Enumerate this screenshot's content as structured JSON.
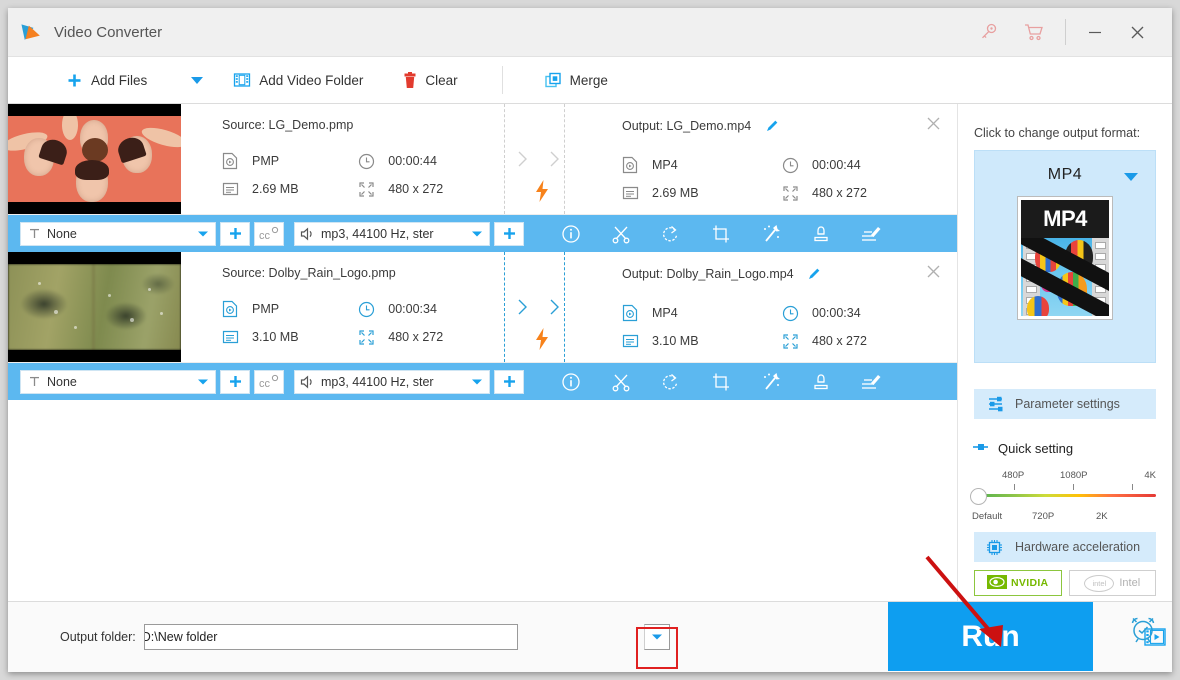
{
  "window": {
    "title": "Video Converter",
    "icons": {
      "key": "key-icon",
      "cart": "cart-icon",
      "minimize": "minimize-icon",
      "close": "close-icon"
    }
  },
  "toolbar": {
    "add_files": "Add Files",
    "add_files_dropdown": "chevron-down-icon",
    "add_video_folder": "Add Video Folder",
    "clear": "Clear",
    "merge": "Merge"
  },
  "files": [
    {
      "source_label": "Source: LG_Demo.pmp",
      "source_format": "PMP",
      "source_duration": "00:00:44",
      "source_size": "2.69 MB",
      "source_resolution": "480 x 272",
      "output_label": "Output: LG_Demo.mp4",
      "output_format": "MP4",
      "output_duration": "00:00:44",
      "output_size": "2.69 MB",
      "output_resolution": "480 x 272",
      "subtitle_track": "None",
      "audio_track": "mp3, 44100 Hz, ster",
      "active": false
    },
    {
      "source_label": "Source: Dolby_Rain_Logo.pmp",
      "source_format": "PMP",
      "source_duration": "00:00:34",
      "source_size": "3.10 MB",
      "source_resolution": "480 x 272",
      "output_label": "Output: Dolby_Rain_Logo.mp4",
      "output_format": "MP4",
      "output_duration": "00:00:34",
      "output_size": "3.10 MB",
      "output_resolution": "480 x 272",
      "subtitle_track": "None",
      "audio_track": "mp3, 44100 Hz, ster",
      "active": true
    }
  ],
  "strip_tools": [
    "info-icon",
    "cut-icon",
    "rotate-icon",
    "crop-icon",
    "effect-icon",
    "watermark-icon",
    "subtitle-icon"
  ],
  "right_panel": {
    "change_format_label": "Click to change output format:",
    "format_name": "MP4",
    "format_thumb_text": "MP4",
    "parameter_settings": "Parameter settings",
    "quick_setting": "Quick setting",
    "slider": {
      "top_ticks": [
        "480P",
        "1080P",
        "4K"
      ],
      "bottom_ticks": [
        "Default",
        "720P",
        "2K"
      ],
      "value": "Default"
    },
    "hardware_acceleration": "Hardware acceleration",
    "gpu_nvidia": "NVIDIA",
    "gpu_intel": "Intel"
  },
  "bottom": {
    "output_folder_label": "Output folder:",
    "output_folder_value": "D:\\New folder",
    "dropdown_icon": "chevron-down-icon",
    "browse_icon": "folder-icon",
    "open_output_icon": "film-folder-icon",
    "run_label": "Run",
    "schedule_icon": "alarm-clock-icon"
  },
  "colors": {
    "accent_blue": "#0e9ef0",
    "strip_blue": "#5cb8f0",
    "panel_blue": "#cfe9fb",
    "bolt_orange": "#f7821b",
    "highlight_red": "#e02020",
    "nvidia_green": "#76b900"
  }
}
